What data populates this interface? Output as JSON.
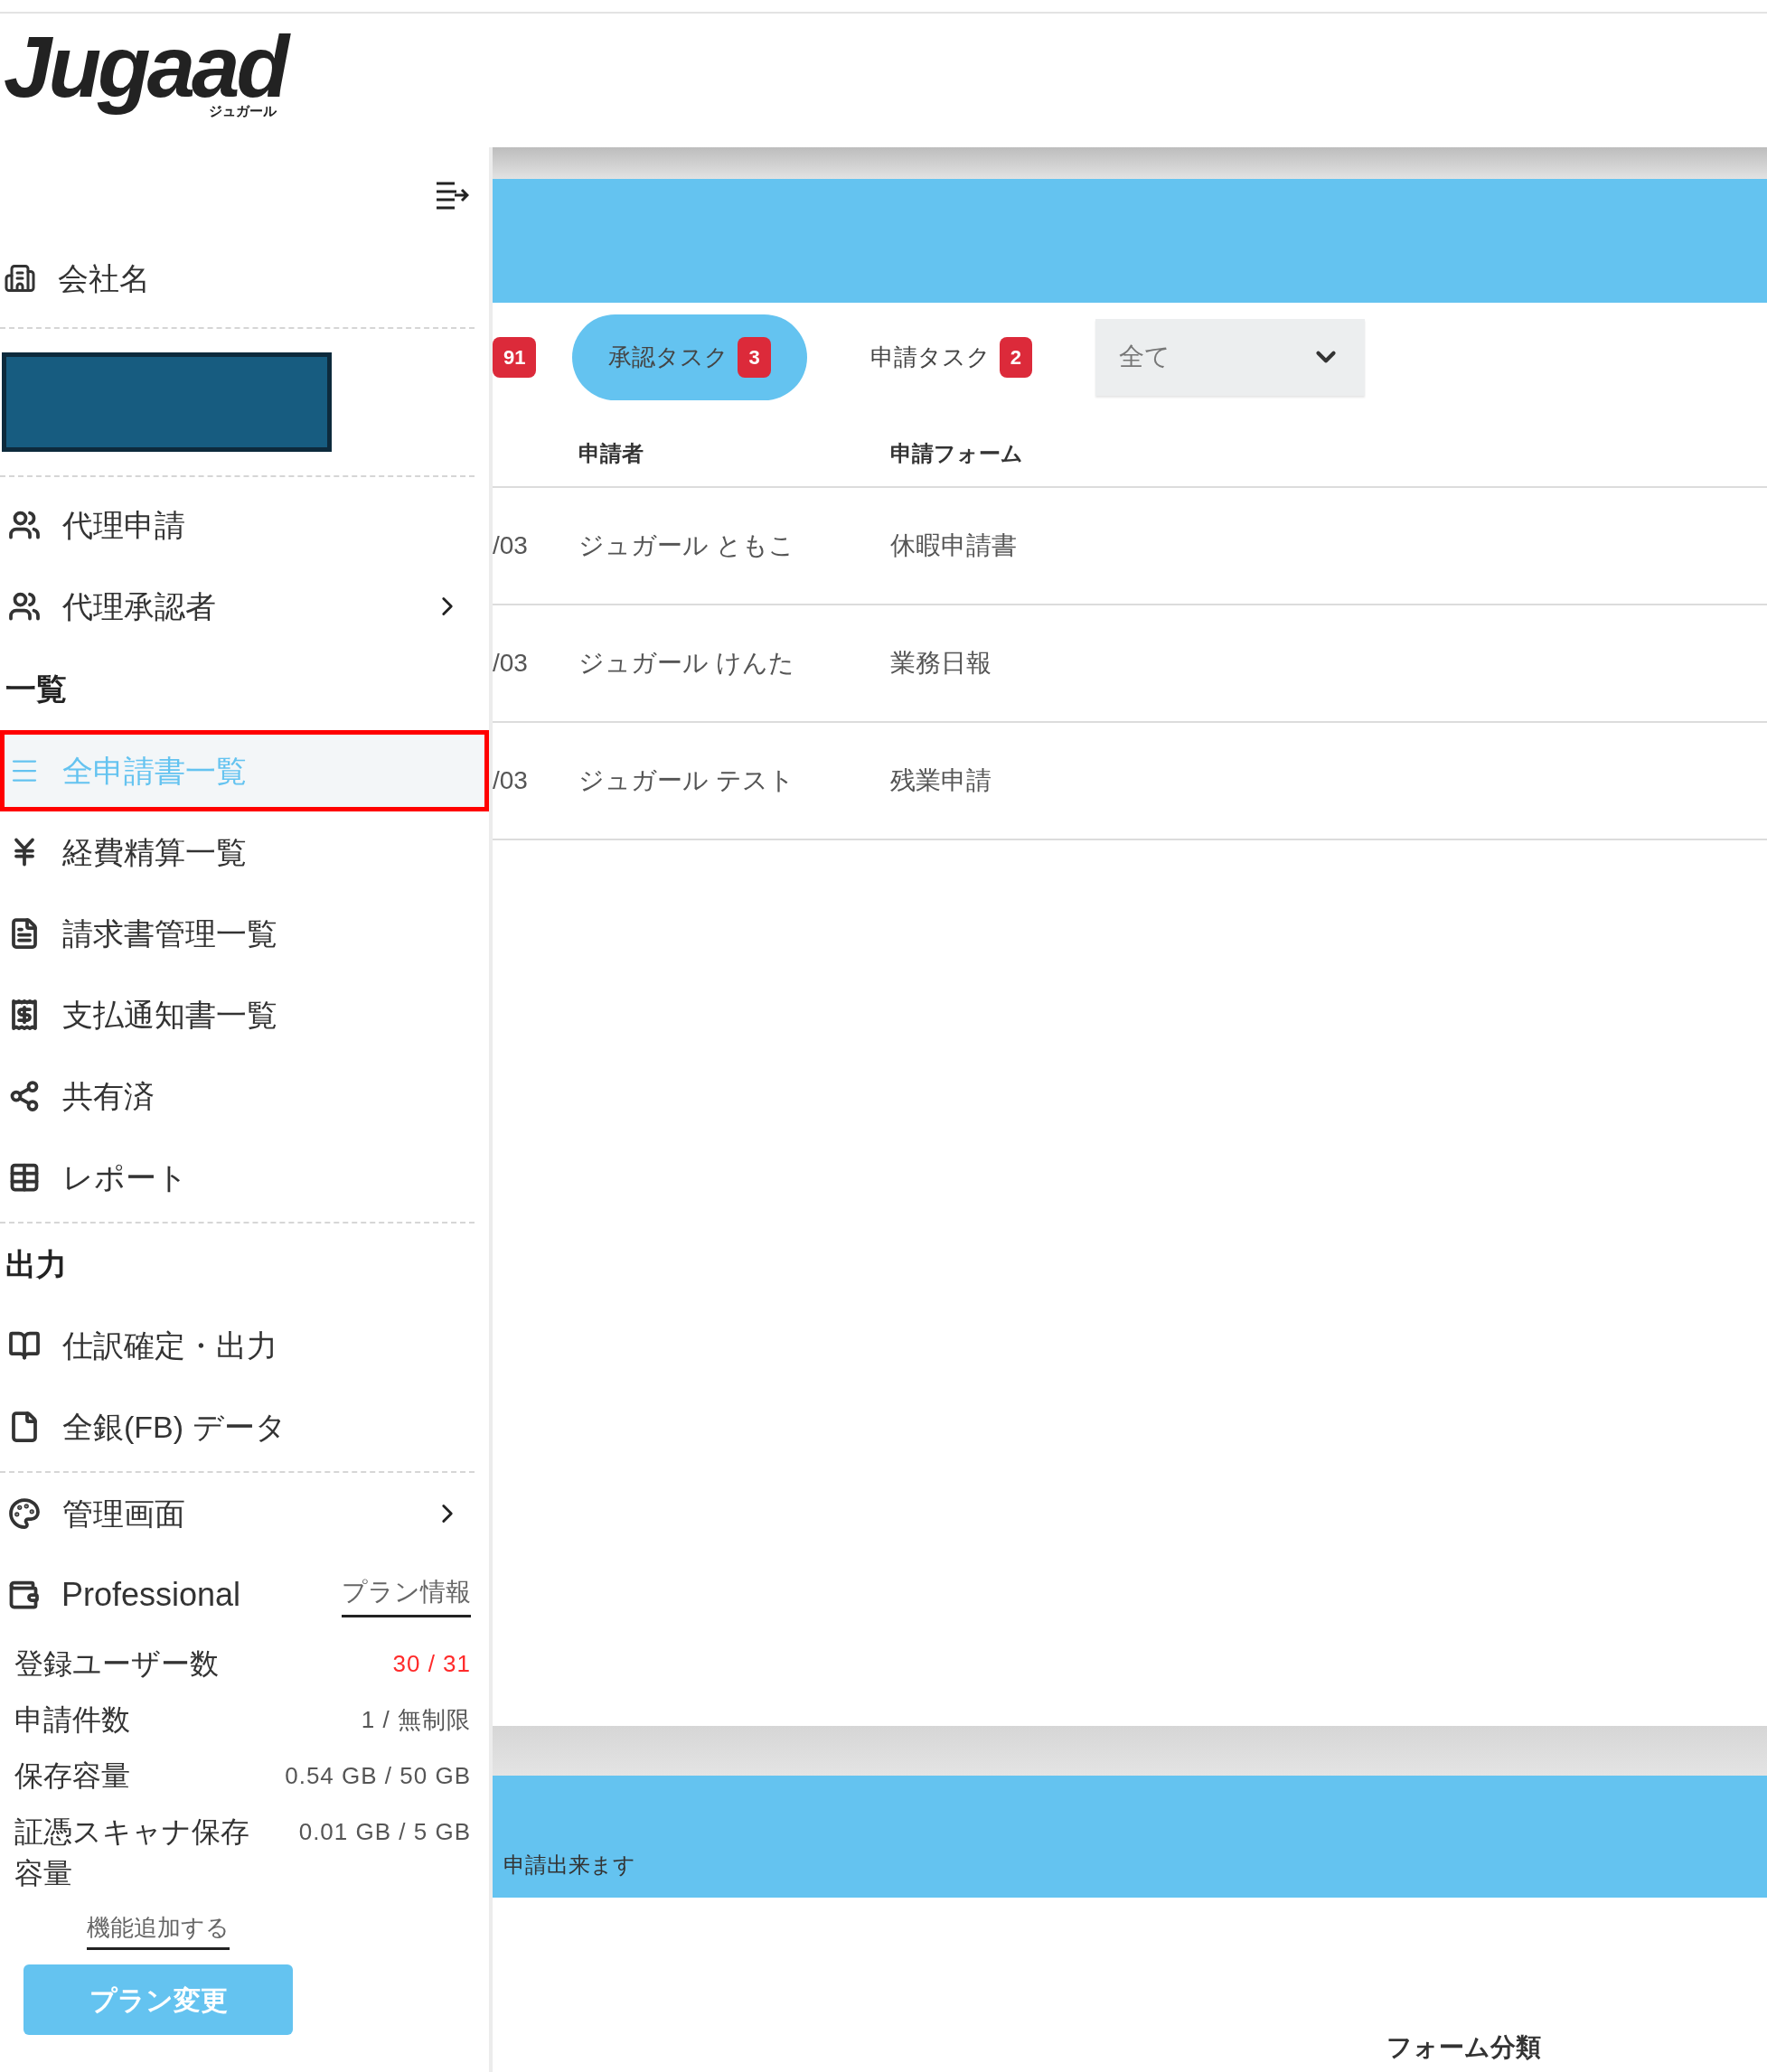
{
  "logo": {
    "text": "Jugaad",
    "subtext": "ジュガール"
  },
  "sidebar": {
    "company": {
      "label": "会社名"
    },
    "delegation": [
      {
        "label": "代理申請",
        "selected": false,
        "highlighted": false,
        "submenu": false
      },
      {
        "label": "代理承認者",
        "selected": false,
        "highlighted": false,
        "submenu": true
      }
    ],
    "lists": {
      "heading": "一覧",
      "items": [
        {
          "label": "全申請書一覧",
          "selected": true,
          "highlighted": true,
          "submenu": false
        },
        {
          "label": "経費精算一覧",
          "selected": false,
          "highlighted": false,
          "submenu": false
        },
        {
          "label": "請求書管理一覧",
          "selected": false,
          "highlighted": false,
          "submenu": false
        },
        {
          "label": "支払通知書一覧",
          "selected": false,
          "highlighted": false,
          "submenu": false
        },
        {
          "label": "共有済",
          "selected": false,
          "highlighted": false,
          "submenu": false
        },
        {
          "label": "レポート",
          "selected": false,
          "highlighted": false,
          "submenu": false
        }
      ]
    },
    "output": {
      "heading": "出力",
      "items": [
        {
          "label": "仕訳確定・出力",
          "selected": false,
          "highlighted": false,
          "submenu": false
        },
        {
          "label": "全銀(FB) データ",
          "selected": false,
          "highlighted": false,
          "submenu": false
        }
      ]
    },
    "admin": [
      {
        "label": "管理画面",
        "selected": false,
        "highlighted": false,
        "submenu": true
      }
    ],
    "plan": {
      "name": "Professional",
      "info_link": "プラン情報",
      "stats": [
        {
          "label": "登録ユーザー数",
          "value": "30 / 31",
          "over_limit": true
        },
        {
          "label": "申請件数",
          "value": "1 / 無制限",
          "over_limit": false
        },
        {
          "label": "保存容量",
          "value": "0.54 GB / 50 GB",
          "over_limit": false
        },
        {
          "label": "証憑スキャナ保存容量",
          "value": "0.01 GB / 5 GB",
          "over_limit": false
        }
      ],
      "add_feature_link": "機能追加する",
      "change_button": "プラン変更"
    }
  },
  "tabs": [
    {
      "badge": "91",
      "selected": false
    },
    {
      "label": "承認タスク",
      "badge": "3",
      "selected": true
    },
    {
      "label": "申請タスク",
      "badge": "2",
      "selected": false
    }
  ],
  "filter": {
    "value": "全て"
  },
  "table": {
    "columns": [
      null,
      "申請者",
      "申請フォーム"
    ],
    "rows": [
      [
        "/03",
        "ジュガール ともこ",
        "休暇申請書"
      ],
      [
        "/03",
        "ジュガール けんた",
        "業務日報"
      ],
      [
        "/03",
        "ジュガール テスト",
        "残業申請"
      ]
    ]
  },
  "banner": {
    "text": "申請出来ます"
  },
  "footer_heading": "フォーム分類"
}
